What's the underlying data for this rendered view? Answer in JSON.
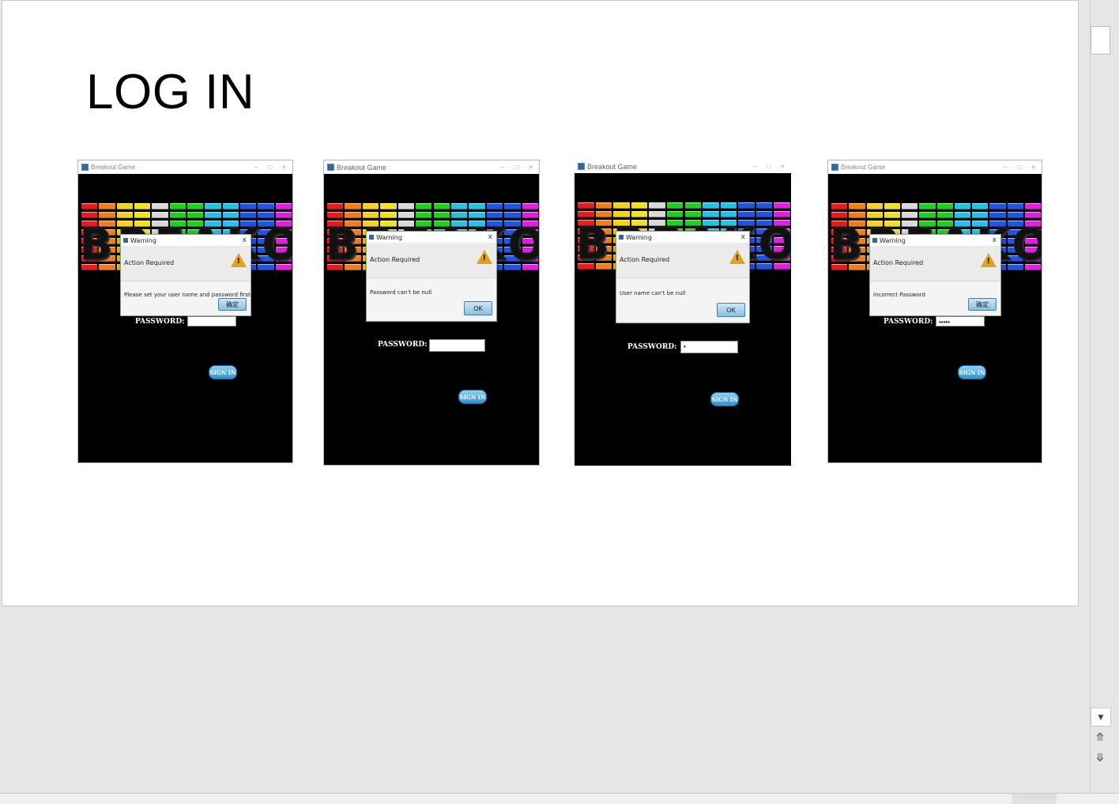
{
  "slide": {
    "title": "LOG IN"
  },
  "screenshots": [
    {
      "window_title": "Breakout Game",
      "dialog_title": "Warning",
      "dialog_header": "Action Required",
      "dialog_message": "Please set your user name and password first",
      "dialog_button": "确定",
      "password_label": "PASSWORD:",
      "password_value": "",
      "signin_label": "SIGN IN"
    },
    {
      "window_title": "Breakout Game",
      "dialog_title": "Warning",
      "dialog_header": "Action Required",
      "dialog_message": "Password can't be null",
      "dialog_button": "OK",
      "password_label": "PASSWORD:",
      "password_value": "",
      "signin_label": "SIGN IN"
    },
    {
      "window_title": "Breakout Game",
      "dialog_title": "Warning",
      "dialog_header": "Action Required",
      "dialog_message": "User name can't be null",
      "dialog_button": "OK",
      "password_label": "PASSWORD:",
      "password_value": "•",
      "signin_label": "SIGN IN"
    },
    {
      "window_title": "Breakout Game",
      "dialog_title": "Warning",
      "dialog_header": "Action Required",
      "dialog_message": "Incorrect Password",
      "dialog_button": "确定",
      "password_label": "PASSWORD:",
      "password_value": "•••••",
      "signin_label": "SIGN IN"
    }
  ],
  "game_title_text": "BREAKOUT",
  "brick_colors": [
    "#e81c1c",
    "#f07d1a",
    "#f2d21b",
    "#f2e21b",
    "#d8d8d8",
    "#1fd11f",
    "#1fd11f",
    "#23c2e8",
    "#23c2e8",
    "#1f55e0",
    "#1f55e0",
    "#e21fe0"
  ],
  "window_controls": [
    "–",
    "□",
    "×"
  ],
  "dialog_close": "x",
  "scrollbar": {
    "up_icon": "scroll-down-arrow-icon",
    "prev_icon": "prev-page-icon",
    "next_icon": "next-page-icon"
  }
}
